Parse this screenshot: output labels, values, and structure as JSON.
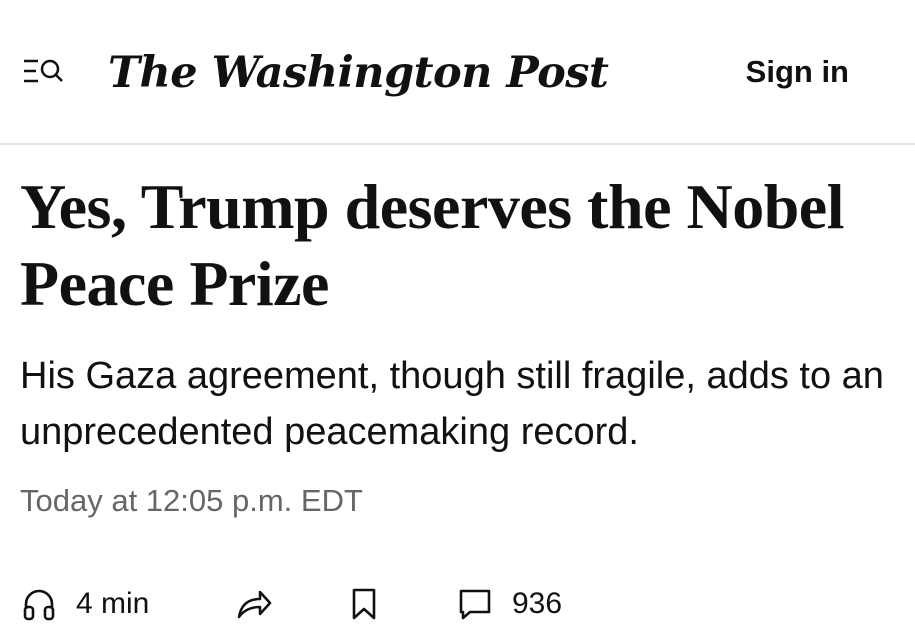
{
  "header": {
    "logo_text": "The Washington Post",
    "sign_in_label": "Sign in",
    "menu_icon": "menu-search-icon"
  },
  "article": {
    "headline": "Yes, Trump deserves the Nobel Peace Prize",
    "dek": "His Gaza agreement, though still fragile, adds to an unprecedented peacemaking record.",
    "timestamp": "Today at 12:05 p.m. EDT"
  },
  "actions": {
    "listen_label": "4 min",
    "listen_icon": "headphones-icon",
    "share_icon": "share-arrow-icon",
    "save_icon": "bookmark-icon",
    "comments_icon": "comment-icon",
    "comments_count": "936"
  },
  "colors": {
    "text": "#111111",
    "timestamp": "#666666",
    "divider": "#e6e6e6",
    "background": "#ffffff"
  }
}
